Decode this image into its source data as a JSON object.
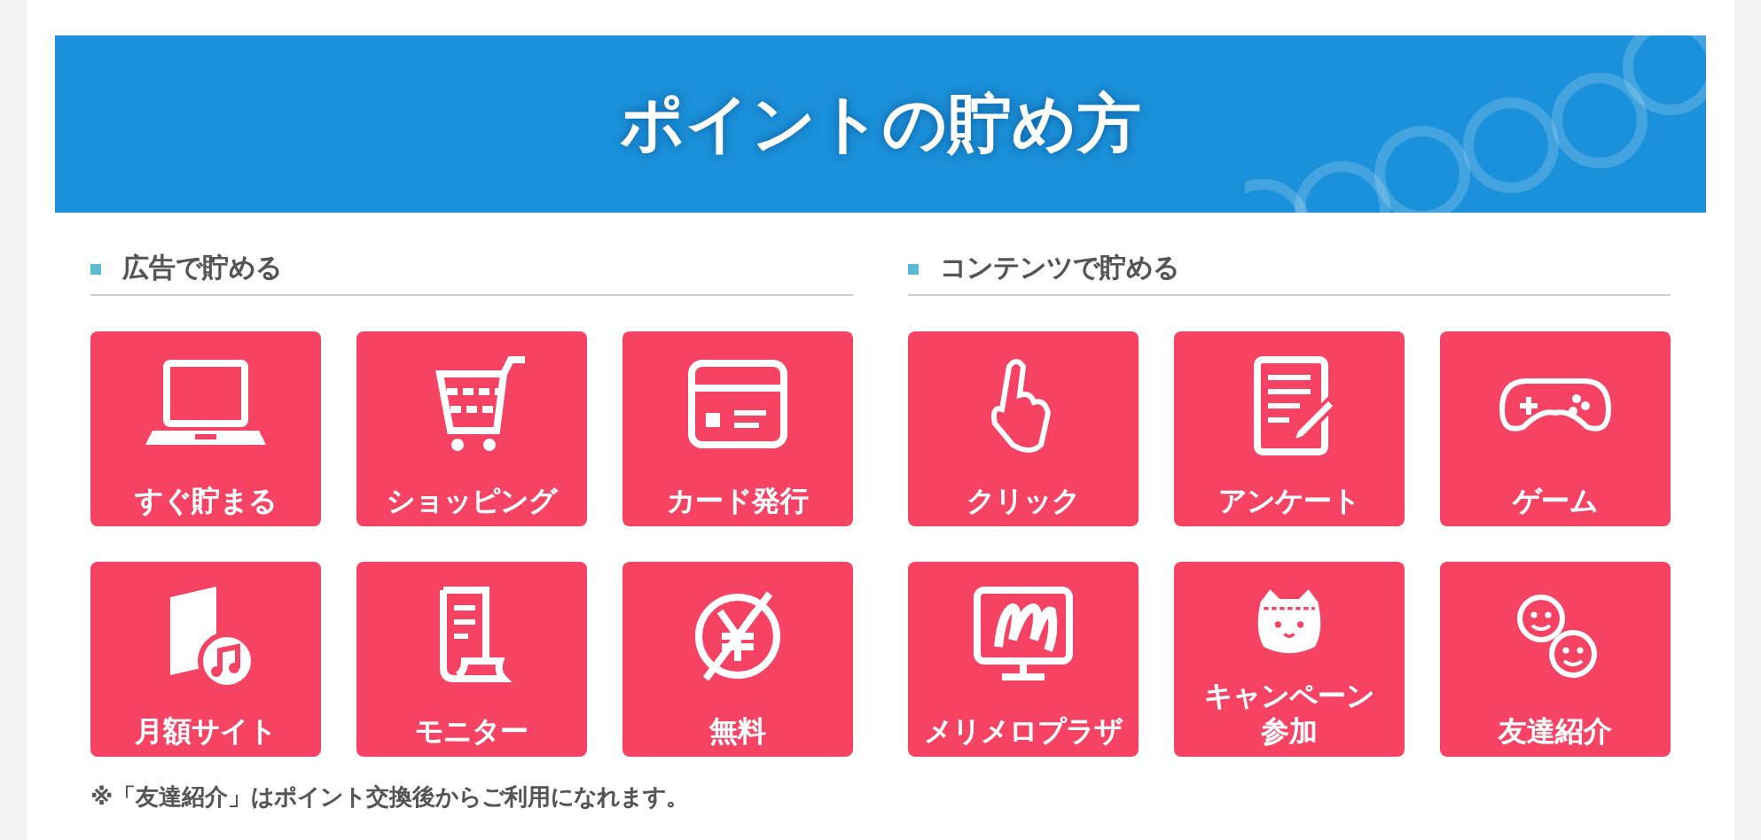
{
  "banner": {
    "title": "ポイントの貯め方"
  },
  "sections": [
    {
      "heading": "広告で貯める",
      "tiles": [
        {
          "label": "すぐ貯まる"
        },
        {
          "label": "ショッピング"
        },
        {
          "label": "カード発行"
        },
        {
          "label": "月額サイト"
        },
        {
          "label": "モニター"
        },
        {
          "label": "無料"
        }
      ]
    },
    {
      "heading": "コンテンツで貯める",
      "tiles": [
        {
          "label": "クリック"
        },
        {
          "label": "アンケート"
        },
        {
          "label": "ゲーム"
        },
        {
          "label": "メリメロプラザ"
        },
        {
          "label": "キャンペーン参加"
        },
        {
          "label": "友達紹介"
        }
      ]
    }
  ],
  "note": "※「友達紹介」はポイント交換後からご利用になれます。"
}
